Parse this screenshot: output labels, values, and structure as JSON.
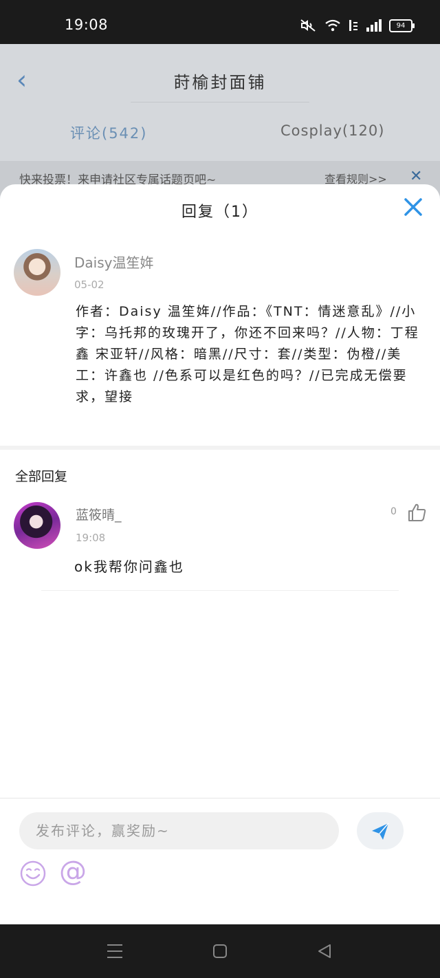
{
  "status_bar": {
    "time": "19:08",
    "battery": "94"
  },
  "background_page": {
    "title": "莳榆封面铺",
    "tabs": [
      {
        "label": "评论(542)"
      },
      {
        "label": "Cosplay(120)"
      }
    ],
    "notice": {
      "text": "快来投票！来申请社区专属话题页吧~",
      "link": "查看规则>>"
    }
  },
  "sheet": {
    "title": "回复（1）",
    "comment": {
      "author": "Daisy温笙姩",
      "date": "05-02",
      "content": "作者：Daisy 温笙姩//作品：《TNT：情迷意乱》//小字：乌托邦的玫瑰开了，你还不回来吗？//人物：丁程鑫 宋亚轩//风格：暗黑//尺寸：套//类型：伪橙//美工：许鑫也 //色系可以是红色的吗？//已完成无偿要求，望接"
    },
    "replies_header": "全部回复",
    "replies": [
      {
        "author": "蓝筱晴_",
        "date": "19:08",
        "content": "ok我帮你问鑫也",
        "likes": "0"
      }
    ]
  },
  "input_bar": {
    "placeholder": "发布评论，赢奖励~"
  },
  "colors": {
    "accent": "#2f93e6",
    "emoji_purple": "#c9a6e8"
  }
}
